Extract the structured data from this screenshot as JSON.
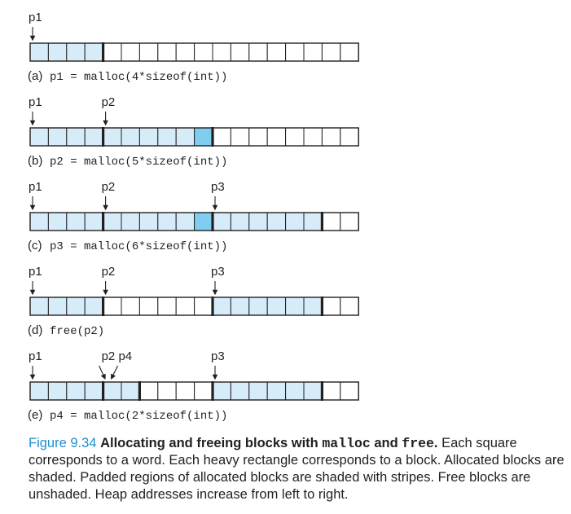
{
  "figure": {
    "num": "Figure 9.34",
    "title_pre": "Allocating and freeing blocks with ",
    "title_code1": "malloc",
    "title_mid": " and ",
    "title_code2": "free",
    "title_post": ".",
    "text": " Each square corresponds to a word. Each heavy rectangle corresponds to a block. Allocated blocks are shaded. Padded regions of allocated blocks are shaded with stripes. Free blocks are unshaded. Heap addresses increase from left to right."
  },
  "colors": {
    "allocated": "#d6ecf8",
    "padding": "#7fcdf0",
    "free": "#ffffff",
    "accent": "#1f8fcf"
  },
  "heap": {
    "total_words": 18,
    "rows": [
      {
        "id": "a",
        "label": "(a)",
        "code": "p1 = malloc(4*sizeof(int))",
        "pointers": [
          {
            "name": "p1",
            "word": 0
          }
        ],
        "boundaries": [
          4
        ],
        "allocated": [
          0,
          1,
          2,
          3
        ],
        "padding": []
      },
      {
        "id": "b",
        "label": "(b)",
        "code": "p2 = malloc(5*sizeof(int))",
        "pointers": [
          {
            "name": "p1",
            "word": 0
          },
          {
            "name": "p2",
            "word": 4
          }
        ],
        "boundaries": [
          4,
          10
        ],
        "allocated": [
          0,
          1,
          2,
          3,
          4,
          5,
          6,
          7,
          8
        ],
        "padding": [
          9
        ]
      },
      {
        "id": "c",
        "label": "(c)",
        "code": "p3 = malloc(6*sizeof(int))",
        "pointers": [
          {
            "name": "p1",
            "word": 0
          },
          {
            "name": "p2",
            "word": 4
          },
          {
            "name": "p3",
            "word": 10
          }
        ],
        "boundaries": [
          4,
          10,
          16
        ],
        "allocated": [
          0,
          1,
          2,
          3,
          4,
          5,
          6,
          7,
          8,
          10,
          11,
          12,
          13,
          14,
          15
        ],
        "padding": [
          9
        ]
      },
      {
        "id": "d",
        "label": "(d)",
        "code": "free(p2)",
        "pointers": [
          {
            "name": "p1",
            "word": 0
          },
          {
            "name": "p2",
            "word": 4
          },
          {
            "name": "p3",
            "word": 10
          }
        ],
        "boundaries": [
          4,
          10,
          16
        ],
        "allocated": [
          0,
          1,
          2,
          3,
          10,
          11,
          12,
          13,
          14,
          15
        ],
        "padding": []
      },
      {
        "id": "e",
        "label": "(e)",
        "code": "p4 = malloc(2*sizeof(int))",
        "pointers": [
          {
            "name": "p1",
            "word": 0
          },
          {
            "name": "p2 p4",
            "word": 4,
            "slanted": true
          },
          {
            "name": "p3",
            "word": 10
          }
        ],
        "boundaries": [
          4,
          6,
          10,
          16
        ],
        "allocated": [
          0,
          1,
          2,
          3,
          4,
          5,
          10,
          11,
          12,
          13,
          14,
          15
        ],
        "padding": []
      }
    ]
  }
}
